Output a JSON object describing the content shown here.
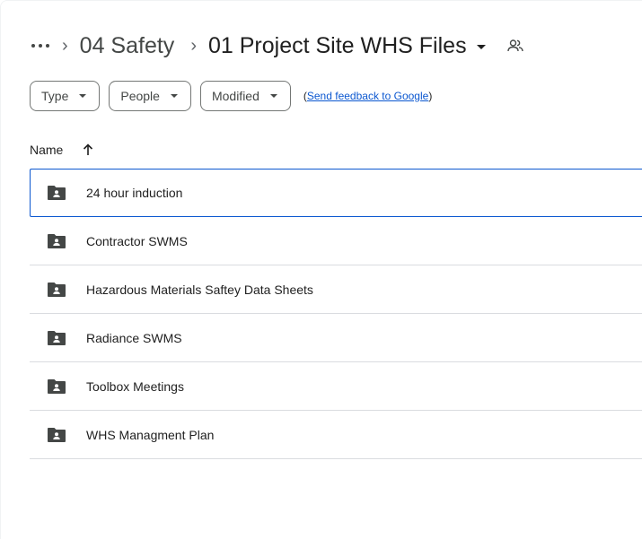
{
  "breadcrumb": {
    "more_glyph": "···",
    "separator": "›",
    "parent": "04 Safety",
    "current": "01 Project Site WHS Files",
    "share_icon": "people-icon"
  },
  "filters": {
    "type_label": "Type",
    "people_label": "People",
    "modified_label": "Modified",
    "feedback_open": "(",
    "feedback_link": "Send feedback to Google",
    "feedback_close": ")"
  },
  "table": {
    "name_header": "Name",
    "sort_icon": "arrow-up-icon",
    "rows": [
      {
        "label": "24 hour induction",
        "icon": "shared-folder-icon",
        "selected": true
      },
      {
        "label": "Contractor SWMS",
        "icon": "shared-folder-icon"
      },
      {
        "label": "Hazardous Materials Saftey Data Sheets",
        "icon": "shared-folder-icon"
      },
      {
        "label": "Radiance SWMS",
        "icon": "shared-folder-icon"
      },
      {
        "label": "Toolbox Meetings",
        "icon": "shared-folder-icon"
      },
      {
        "label": "WHS Managment Plan",
        "icon": "shared-folder-icon"
      }
    ]
  },
  "colors": {
    "selection_border": "#0b57d0",
    "divider": "#dadce0",
    "folder_icon": "#444746",
    "link": "#0b57d0"
  }
}
